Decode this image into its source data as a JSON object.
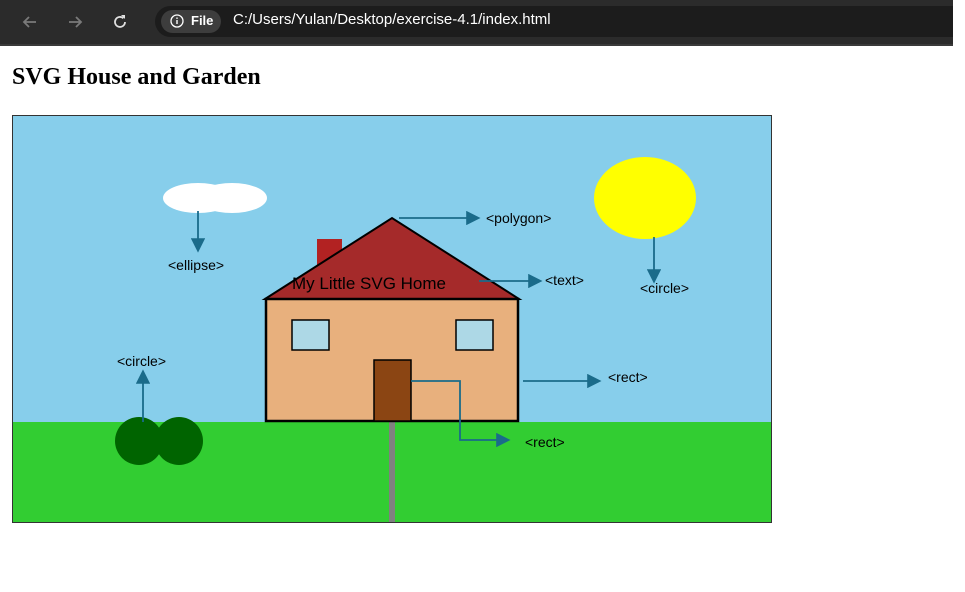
{
  "browser": {
    "back_icon": "arrow-left-icon",
    "forward_icon": "arrow-right-icon",
    "reload_icon": "reload-icon",
    "info_icon": "info-icon",
    "file_label": "File",
    "url": "C:/Users/Yulan/Desktop/exercise-4.1/index.html"
  },
  "page": {
    "title": "SVG House and Garden"
  },
  "scene": {
    "colors": {
      "sky": "#87CEEB",
      "grass": "#32CD32",
      "sun": "#FFFF00",
      "cloud": "#FFFFFF",
      "roof": "#A52A2A",
      "chimney": "#B22222",
      "house": "#E8B07D",
      "window": "#ADD8E6",
      "door": "#8B4513",
      "bush": "#006400",
      "path": "#808080",
      "arrow": "#1A6B8A"
    },
    "house_text": "My Little SVG Home",
    "annotations": {
      "ellipse": "<ellipse>",
      "polygon": "<polygon>",
      "text": "<text>",
      "sun_circle": "<circle>",
      "bush_circle": "<circle>",
      "house_rect": "<rect>",
      "door_rect": "<rect>"
    }
  }
}
